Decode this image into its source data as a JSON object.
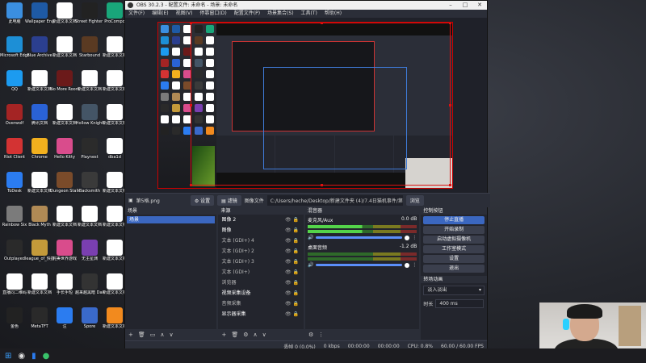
{
  "desktop": {
    "icons": [
      {
        "label": "此电脑",
        "color": "#3b8fe0"
      },
      {
        "label": "Wallpaper Engine",
        "color": "#1e5aa5"
      },
      {
        "label": "新建文本文档",
        "color": "#ffffff"
      },
      {
        "label": "Street Fighter 6",
        "color": "#222222"
      },
      {
        "label": "ProCompo",
        "color": "#19a67a"
      },
      {
        "label": "Microsoft Edge",
        "color": "#1d8fd6"
      },
      {
        "label": "Blue Archive",
        "color": "#2b3f8f"
      },
      {
        "label": "新建文本文档",
        "color": "#ffffff"
      },
      {
        "label": "Starbound",
        "color": "#5a3a22"
      },
      {
        "label": "新建文本文档",
        "color": "#ffffff"
      },
      {
        "label": "QQ",
        "color": "#1c9bf0"
      },
      {
        "label": "新建文本文档",
        "color": "#ffffff"
      },
      {
        "label": "No More Room in Hell",
        "color": "#6b1a1a"
      },
      {
        "label": "新建文本文档",
        "color": "#ffffff"
      },
      {
        "label": "新建文本文档",
        "color": "#ffffff"
      },
      {
        "label": "Overwolf",
        "color": "#a42424"
      },
      {
        "label": "腾讯文档",
        "color": "#2a62d6"
      },
      {
        "label": "新建文本文档",
        "color": "#ffffff"
      },
      {
        "label": "Hollow Knight",
        "color": "#445566"
      },
      {
        "label": "新建文本文档",
        "color": "#ffffff"
      },
      {
        "label": "Riot Client",
        "color": "#d33333"
      },
      {
        "label": "Chrome",
        "color": "#f2b01e"
      },
      {
        "label": "Hello Kitty",
        "color": "#d94c8c"
      },
      {
        "label": "Playnest",
        "color": "#2b2b2b"
      },
      {
        "label": "dba1d",
        "color": "#ffffff"
      },
      {
        "label": "ToDesk",
        "color": "#2b7cf0"
      },
      {
        "label": "新建文本文档",
        "color": "#ffffff"
      },
      {
        "label": "Dungeon Stalkers",
        "color": "#7a4b2a"
      },
      {
        "label": "Backsmith",
        "color": "#3a3a3a"
      },
      {
        "label": "新建文本文档",
        "color": "#ffffff"
      },
      {
        "label": "Rainbow Six",
        "color": "#7b7b7b"
      },
      {
        "label": "Black Myth",
        "color": "#b08a55"
      },
      {
        "label": "新建文本文档",
        "color": "#ffffff"
      },
      {
        "label": "新建文本文档",
        "color": "#ffffff"
      },
      {
        "label": "新建文本文档",
        "color": "#ffffff"
      },
      {
        "label": "Outplayed",
        "color": "#2a2a2a"
      },
      {
        "label": "league_of_快捷方式",
        "color": "#c49a3a"
      },
      {
        "label": "完美世界游戏",
        "color": "#d94c8c"
      },
      {
        "label": "无主星渊",
        "color": "#7a3fb0"
      },
      {
        "label": "新建文本文档",
        "color": "#ffffff"
      },
      {
        "label": "直播同二维码",
        "color": "#ffffff"
      },
      {
        "label": "新建文本文档",
        "color": "#ffffff"
      },
      {
        "label": "手长手短",
        "color": "#ffffff"
      },
      {
        "label": "越来越黑暗 Dark and",
        "color": "#333333"
      },
      {
        "label": "新建文本文档",
        "color": "#ffffff"
      },
      {
        "label": "金色",
        "color": "#222222"
      },
      {
        "label": "MetaTFT",
        "color": "#2a2a2a"
      },
      {
        "label": "注",
        "color": "#2b7cf0"
      },
      {
        "label": "Spore",
        "color": "#3a6acb"
      },
      {
        "label": "新建文本文档",
        "color": "#f28a1e"
      }
    ]
  },
  "obs": {
    "title": "OBS 30.2.3 - 配置文件: 未命名 - 场景: 未命名",
    "menu": [
      "文件(F)",
      "编辑(E)",
      "视图(V)",
      "停靠窗口(D)",
      "配置文件(P)",
      "场景集合(S)",
      "工具(T)",
      "帮助(H)"
    ],
    "source_bar": {
      "selected_source": "第5格.png",
      "settings_label": "设置",
      "filters_label": "滤镜",
      "image_file_label": "图像文件",
      "path": "C:/Users/heche/Desktop/新建文件夹 (4)/7.4日猫机事件/第5格.png",
      "browse_label": "浏览"
    },
    "scenes": {
      "title": "场景",
      "items": [
        "场景"
      ]
    },
    "sources": {
      "title": "来源",
      "items": [
        {
          "label": "图像 2",
          "active": true
        },
        {
          "label": "图像",
          "active": true
        },
        {
          "label": "文本 (GDI+) 4",
          "active": false
        },
        {
          "label": "文本 (GDI+) 2",
          "active": false
        },
        {
          "label": "文本 (GDI+) 3",
          "active": false
        },
        {
          "label": "文本 (GDI+)",
          "active": false
        },
        {
          "label": "浏览器",
          "active": false
        },
        {
          "label": "视频采集设备",
          "active": true
        },
        {
          "label": "音频采集",
          "active": false
        },
        {
          "label": "显示器采集",
          "active": true
        }
      ]
    },
    "mixer": {
      "title": "混音器",
      "tracks": [
        {
          "name": "麦克风/Aux",
          "db": "0.0 dB"
        },
        {
          "name": "桌面音频",
          "db": "-1.2 dB"
        }
      ]
    },
    "controls": {
      "title": "控制按钮",
      "buttons": [
        "停止直播",
        "开始录制",
        "启动虚拟摄像机",
        "工作室模式",
        "设置",
        "退出"
      ]
    },
    "transitions": {
      "title": "转场动画",
      "selected": "淡入淡出",
      "duration_label": "时长",
      "duration_value": "400 ms"
    },
    "status": {
      "dropped": "丢帧 0 (0.0%)",
      "bitrate": "0 kbps",
      "stream_time": "00:00:00",
      "rec_time": "00:00:00",
      "cpu": "CPU: 0.8%",
      "fps": "60.00 / 60.00 FPS"
    }
  }
}
